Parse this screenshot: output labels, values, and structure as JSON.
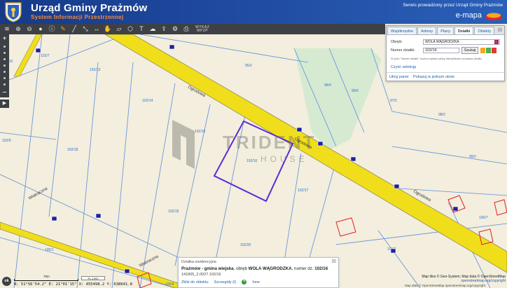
{
  "header": {
    "title": "Urząd Gminy Prażmów",
    "subtitle": "System Informacji Przestrzennej",
    "service_note": "Serwis prowadzony przez Urząd Gminy Prażmów",
    "brand": "e-mapa"
  },
  "toolbar": {
    "icons": [
      "layers-icon",
      "zoom-in-icon",
      "zoom-out-icon",
      "zoom-extent-icon",
      "identify-icon",
      "pencil-icon",
      "draw-line-icon",
      "measure-icon",
      "distance-icon",
      "hand-icon",
      "area-icon",
      "polygon-icon",
      "text-icon",
      "cloud-icon",
      "share-icon",
      "settings-icon",
      "print-icon"
    ],
    "wykaz_label_line1": "WYKAZ",
    "wykaz_label_line2": "MPZP"
  },
  "panel": {
    "tabs": [
      "Współrzędne",
      "Adresy",
      "Plany",
      "Działki",
      "Obiekty"
    ],
    "active_tab": "Działki",
    "obreb_label": "Obręb:",
    "obreb_value": "WOLA WĄGRODZKA",
    "numer_label": "Numer działki:",
    "numer_value": "102/16",
    "search_button": "Szukaj",
    "hint": "W polu \"Numer działki\" można wpisać pełny identyfikator szukanej działki.",
    "clear_link": "Czyść selekcję",
    "hide_link": "Ukryj panel",
    "show_window_link": "Pokazuj w jednym oknie"
  },
  "popup": {
    "title": "Działka ewidencyjna",
    "commune": "Prażmów - gmina wiejska",
    "obreb_prefix": ", obręb ",
    "obreb": "WOLA WĄGRODZKA",
    "numer_prefix": ", numer dz. ",
    "numer": "102/16",
    "identifier": "141805_2.0027.102/16",
    "link_zoom": "Zbliż do obiektu",
    "link_details": "Szczegóły (I)",
    "link_more": "Inne"
  },
  "status": {
    "ok": "ok",
    "coords": "N: 51°56'54.2\"  E: 21°01'15\"    X: 455498.2  Y: 638641.8",
    "scale_label": "70m",
    "projection": "PL-1992"
  },
  "map": {
    "streets": [
      "Ogrodowa",
      "Ogrodowa",
      "Ogrodowa",
      "Wiatraczna",
      "Wiatraczna"
    ],
    "parcel_labels": [
      "102/7",
      "102/13",
      "95/2",
      "96/4",
      "96/6",
      "97/2",
      "98/2",
      "99/2",
      "102/14",
      "102/15",
      "102/16",
      "102/17",
      "102/18",
      "102/19",
      "102/20",
      "102/9",
      "102/10",
      "105/1",
      "103/2",
      "100/7",
      "106/4"
    ],
    "watermark_main": "TRIDENT",
    "watermark_sub": "HOUSE",
    "attribution_tiles": "Map tiles © Geo-System; Map data © OpenStreetMap",
    "attribution_osm": "openstreetmap.org/copyright",
    "attribution_bottom": "Map data © OpenStreetMap openstreetmap.org/copyright"
  },
  "colors": {
    "header_bg": "#1f4aa0",
    "subtitle": "#ff8a2e",
    "road": "#f1de1a",
    "parcel_line": "#5c8fdc",
    "selection": "#5a2bd6",
    "green_strip": "#d6ead2"
  }
}
